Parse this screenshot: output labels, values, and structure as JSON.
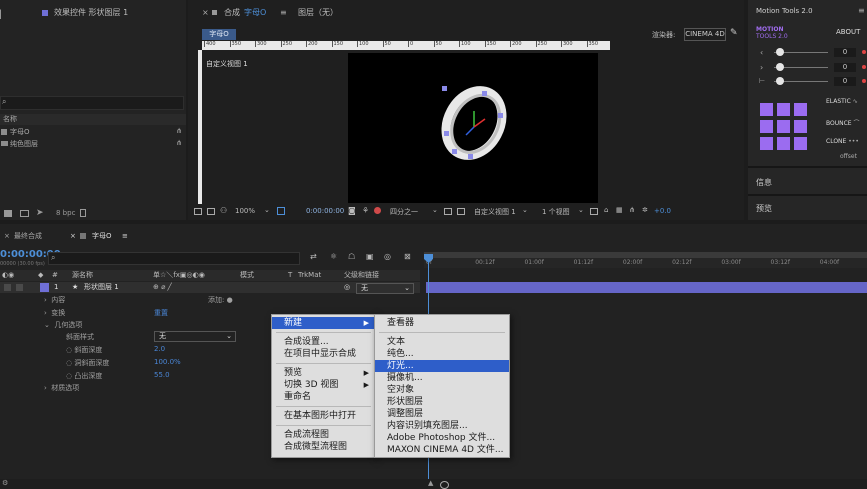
{
  "project_panel": {
    "tab_title": "效果控件 形状图层 1",
    "name_header": "名称",
    "items": [
      "字母O",
      "纯色图层"
    ],
    "bpc": "8 bpc"
  },
  "comp_panel": {
    "tab_prefix": "合成",
    "tab_name": "字母O",
    "layer_tab": "图层（无）",
    "comp_tag": "字母O",
    "renderer_label": "渲染器:",
    "renderer_value": "CINEMA 4D",
    "view_label": "自定义视图 1",
    "ruler_ticks": [
      "400",
      "350",
      "300",
      "250",
      "200",
      "150",
      "100",
      "50",
      "0",
      "50",
      "100",
      "150",
      "200",
      "250",
      "300",
      "350"
    ],
    "zoom": "100%",
    "timecode": "0:00:00:00",
    "resolution": "四分之一",
    "view_select": "自定义视图 1",
    "views_count": "1 个视图",
    "exposure": "+0.0"
  },
  "motion_tools": {
    "title": "Motion Tools 2.0",
    "logo_line1": "MOTION",
    "logo_line2": "TOOLS 2.0",
    "about": "ABOUT",
    "slider_values": [
      "0",
      "0",
      "0"
    ],
    "elastic": "ELASTIC",
    "bounce": "BOUNCE",
    "clone": "CLONE",
    "offset": "offset",
    "info": "信息",
    "preview": "预览"
  },
  "timeline": {
    "tabs": [
      "最终合成",
      "字母O"
    ],
    "timecode": "0:00:00:00",
    "fps": "00000 (30.00 fps)",
    "search_placeholder": "",
    "col_source": "源名称",
    "col_switches": "单☆＼fx▣◎◐◉",
    "col_mode": "模式",
    "col_t": "T",
    "col_trkmat": "TrkMat",
    "col_parent": "父级和链接",
    "layer_num": "1",
    "layer_name": "形状图层 1",
    "parent_value": "无",
    "props": [
      {
        "label": "内容",
        "value": "添加:"
      },
      {
        "label": "变换",
        "value": "重置"
      },
      {
        "label": "几何选项",
        "value": ""
      },
      {
        "label": "斜面样式",
        "value": "无"
      },
      {
        "label": "斜面深度",
        "value": "2.0"
      },
      {
        "label": "洞斜面深度",
        "value": "100.0%"
      },
      {
        "label": "凸出深度",
        "value": "55.0"
      },
      {
        "label": "材质选项",
        "value": ""
      }
    ],
    "time_ticks": [
      "0f",
      "00:12f",
      "01:00f",
      "01:12f",
      "02:00f",
      "02:12f",
      "03:00f",
      "03:12f",
      "04:00f"
    ]
  },
  "context_menu": {
    "items": [
      {
        "label": "新建",
        "submenu": true,
        "highlighted": true
      },
      {
        "label": "合成设置...",
        "submenu": false
      },
      {
        "label": "在项目中显示合成",
        "submenu": false
      },
      {
        "label": "预览",
        "submenu": true
      },
      {
        "label": "切换 3D 视图",
        "submenu": true
      },
      {
        "label": "重命名",
        "submenu": false
      },
      {
        "label": "在基本图形中打开",
        "submenu": false
      },
      {
        "label": "合成流程图",
        "submenu": false
      },
      {
        "label": "合成微型流程图",
        "submenu": false
      }
    ]
  },
  "submenu": {
    "items": [
      {
        "label": "查看器"
      },
      {
        "label": "文本"
      },
      {
        "label": "纯色..."
      },
      {
        "label": "灯光...",
        "highlighted": true
      },
      {
        "label": "摄像机..."
      },
      {
        "label": "空对象"
      },
      {
        "label": "形状图层"
      },
      {
        "label": "调整图层"
      },
      {
        "label": "内容识别填充图层..."
      },
      {
        "label": "Adobe Photoshop 文件..."
      },
      {
        "label": "MAXON CINEMA 4D 文件..."
      }
    ]
  },
  "colors": {
    "accent_blue": "#2e5ec9",
    "layer_purple": "#6f6fd6",
    "motion_purple": "#9b6cf0",
    "playhead": "#4d8fd8"
  }
}
